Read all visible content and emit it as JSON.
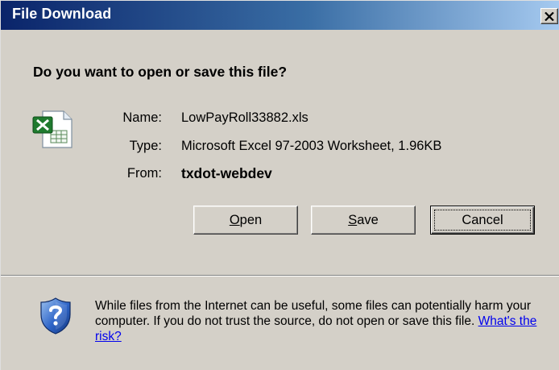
{
  "window": {
    "title": "File Download",
    "close_symbol": "×",
    "close_icon": "close-icon"
  },
  "dialog": {
    "question": "Do you want to open or save this file?",
    "file_icon": "excel-file-icon",
    "fields": {
      "name_label": "Name:",
      "name_value": "LowPayRoll33882.xls",
      "type_label": "Type:",
      "type_value": "Microsoft Excel 97-2003 Worksheet, 1.96KB",
      "from_label": "From:",
      "from_value": "txdot-webdev"
    },
    "buttons": {
      "open": {
        "mnemonic": "O",
        "rest": "pen"
      },
      "save": {
        "mnemonic": "S",
        "rest": "ave"
      },
      "cancel": {
        "label": "Cancel"
      }
    }
  },
  "warning": {
    "icon": "security-shield-question-icon",
    "text": "While files from the Internet can be useful, some files can potentially harm your computer. If you do not trust the source, do not open or save this file.",
    "link_text": "What's the risk?"
  },
  "colors": {
    "title_gradient_start": "#0a246a",
    "title_gradient_end": "#a6caf0",
    "dialog_bg": "#d4d0c8",
    "link": "#0000ee"
  }
}
